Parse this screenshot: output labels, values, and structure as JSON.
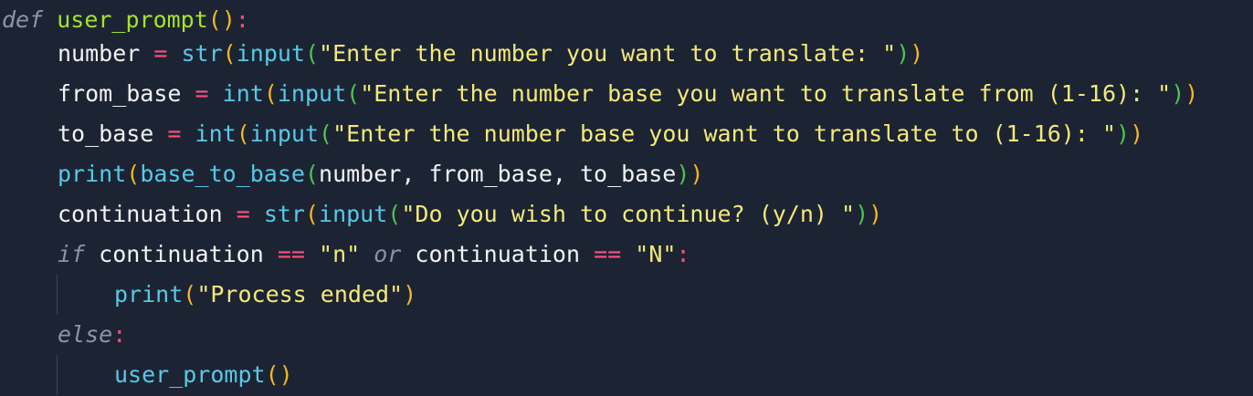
{
  "code": {
    "l1": {
      "kw": "def",
      "fn": "user_prompt",
      "open": "(",
      "close": ")",
      "colon": ":"
    },
    "l2": {
      "var": "number",
      "eq": "=",
      "f1": "str",
      "p1o": "(",
      "f2": "input",
      "p2o": "(",
      "s": "\"Enter the number you want to translate: \"",
      "p2c": ")",
      "p1c": ")"
    },
    "l3": {
      "var": "from_base",
      "eq": "=",
      "f1": "int",
      "p1o": "(",
      "f2": "input",
      "p2o": "(",
      "s": "\"Enter the number base you want to translate from (1-16): \"",
      "p2c": ")",
      "p1c": ")"
    },
    "l4": {
      "var": "to_base",
      "eq": "=",
      "f1": "int",
      "p1o": "(",
      "f2": "input",
      "p2o": "(",
      "s": "\"Enter the number base you want to translate to (1-16): \"",
      "p2c": ")",
      "p1c": ")"
    },
    "l5": {
      "f1": "print",
      "p1o": "(",
      "f2": "base_to_base",
      "p2o": "(",
      "args": "number, from_base, to_base",
      "p2c": ")",
      "p1c": ")"
    },
    "l6": {
      "var": "continuation",
      "eq": "=",
      "f1": "str",
      "p1o": "(",
      "f2": "input",
      "p2o": "(",
      "s": "\"Do you wish to continue? (y/n) \"",
      "p2c": ")",
      "p1c": ")"
    },
    "l7": {
      "kw": "if",
      "v1": "continuation",
      "op1": "==",
      "s1": "\"n\"",
      "kw2": "or",
      "v2": "continuation",
      "op2": "==",
      "s2": "\"N\"",
      "colon": ":"
    },
    "l8": {
      "f1": "print",
      "p1o": "(",
      "s": "\"Process ended\"",
      "p1c": ")"
    },
    "l9": {
      "kw": "else",
      "colon": ":"
    },
    "l10": {
      "f1": "user_prompt",
      "p1o": "(",
      "p1c": ")"
    }
  },
  "colors": {
    "background": "#1c2433",
    "keyword": "#8a95a8",
    "function_def": "#a6e22e",
    "builtin": "#58c8e8",
    "operator": "#ff4f7a",
    "string": "#f4e97a",
    "paren_level1": "#f5b623",
    "paren_level2": "#4fc24f",
    "paren_level3": "#5fa8ff"
  }
}
